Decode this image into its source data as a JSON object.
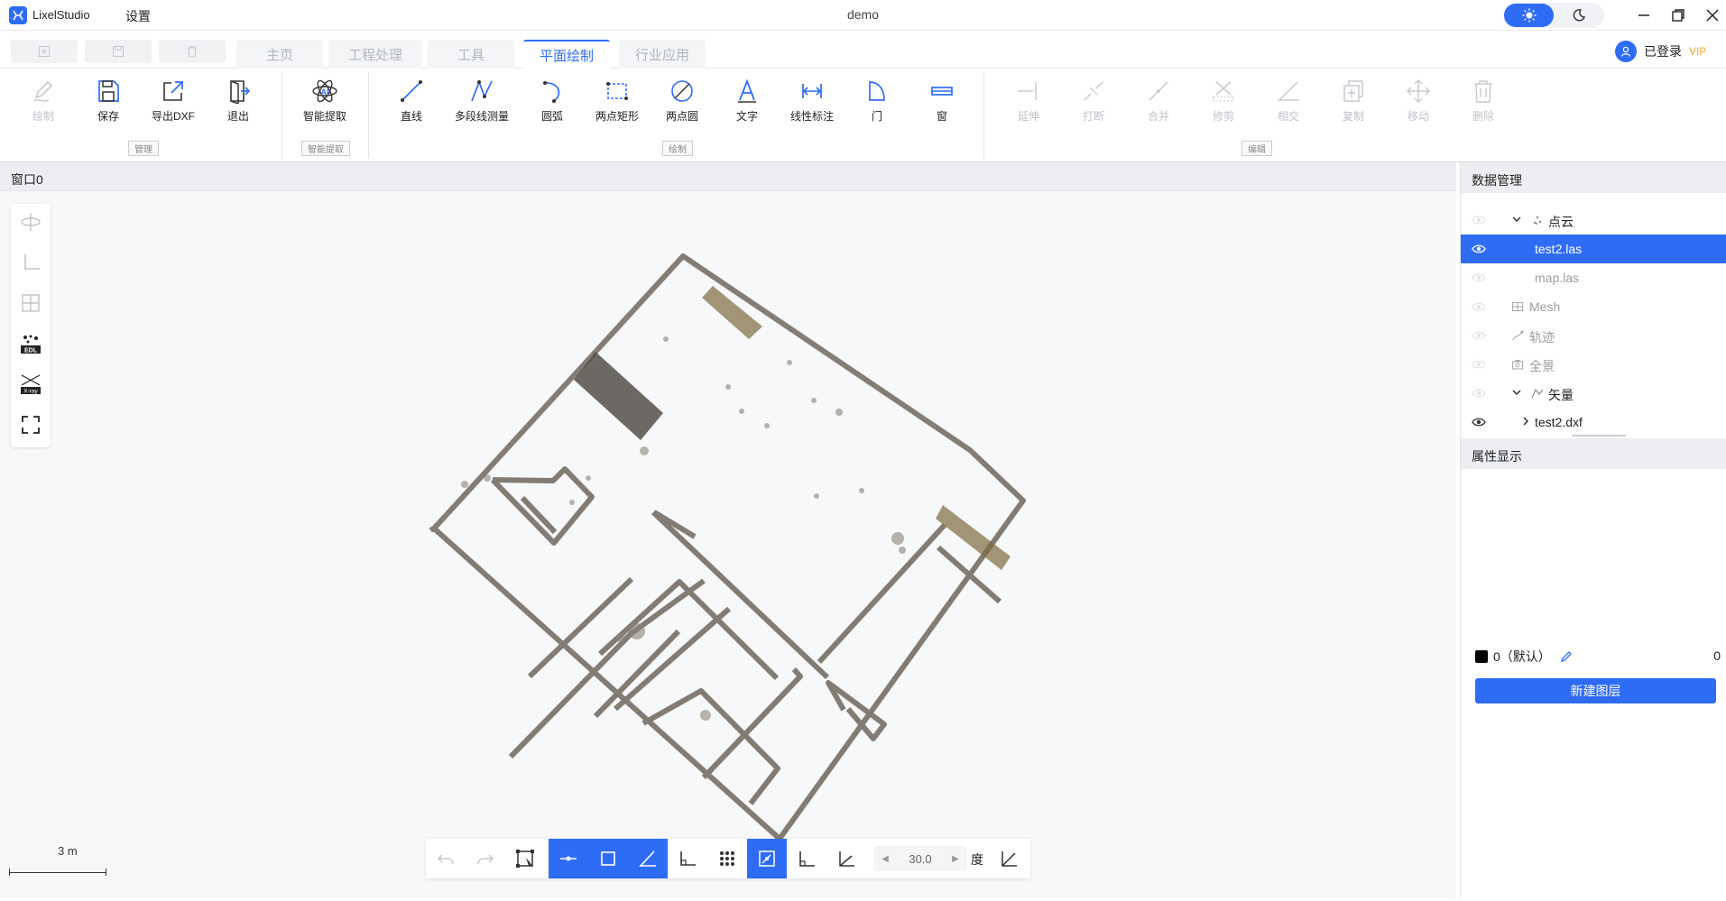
{
  "app": {
    "name": "LixelStudio",
    "window_title": "demo",
    "settings_menu": "设置"
  },
  "user": {
    "label": "已登录",
    "badge": "VIP"
  },
  "tabs": [
    {
      "label": "主页",
      "active": false
    },
    {
      "label": "工程处理",
      "active": false
    },
    {
      "label": "工具",
      "active": false
    },
    {
      "label": "平面绘制",
      "active": true
    },
    {
      "label": "行业应用",
      "active": false
    }
  ],
  "ribbon": {
    "draw": "绘制",
    "save": "保存",
    "export_dxf": "导出DXF",
    "exit": "退出",
    "smart_extract": "智能提取",
    "line": "直线",
    "polyline_measure": "多段线测量",
    "arc": "圆弧",
    "two_point_rect": "两点矩形",
    "two_point_circle": "两点圆",
    "text": "文字",
    "linear_dim": "线性标注",
    "door": "门",
    "window": "窗",
    "extend": "延伸",
    "break": "打断",
    "merge": "合并",
    "trim": "修剪",
    "intersect": "相交",
    "copy": "复制",
    "move": "移动",
    "delete": "删除",
    "group_manage": "管理",
    "group_smart": "智能提取",
    "group_draw": "绘制",
    "group_edit": "编辑"
  },
  "viewport": {
    "title": "窗口0",
    "scale_label": "3 m",
    "angle_value": "30.0",
    "angle_unit": "度"
  },
  "data_panel": {
    "title": "数据管理",
    "items": [
      {
        "label": "点云"
      },
      {
        "label": "test2.las"
      },
      {
        "label": "map.las"
      },
      {
        "label": "Mesh"
      },
      {
        "label": "轨迹"
      },
      {
        "label": "全景"
      },
      {
        "label": "矢量"
      },
      {
        "label": "test2.dxf"
      }
    ]
  },
  "props_panel": {
    "title": "属性显示",
    "layer_name": "0（默认）",
    "layer_count": "0",
    "new_layer": "新建图层"
  },
  "colors": {
    "accent": "#2f6cf6",
    "vip": "#f5a623"
  }
}
